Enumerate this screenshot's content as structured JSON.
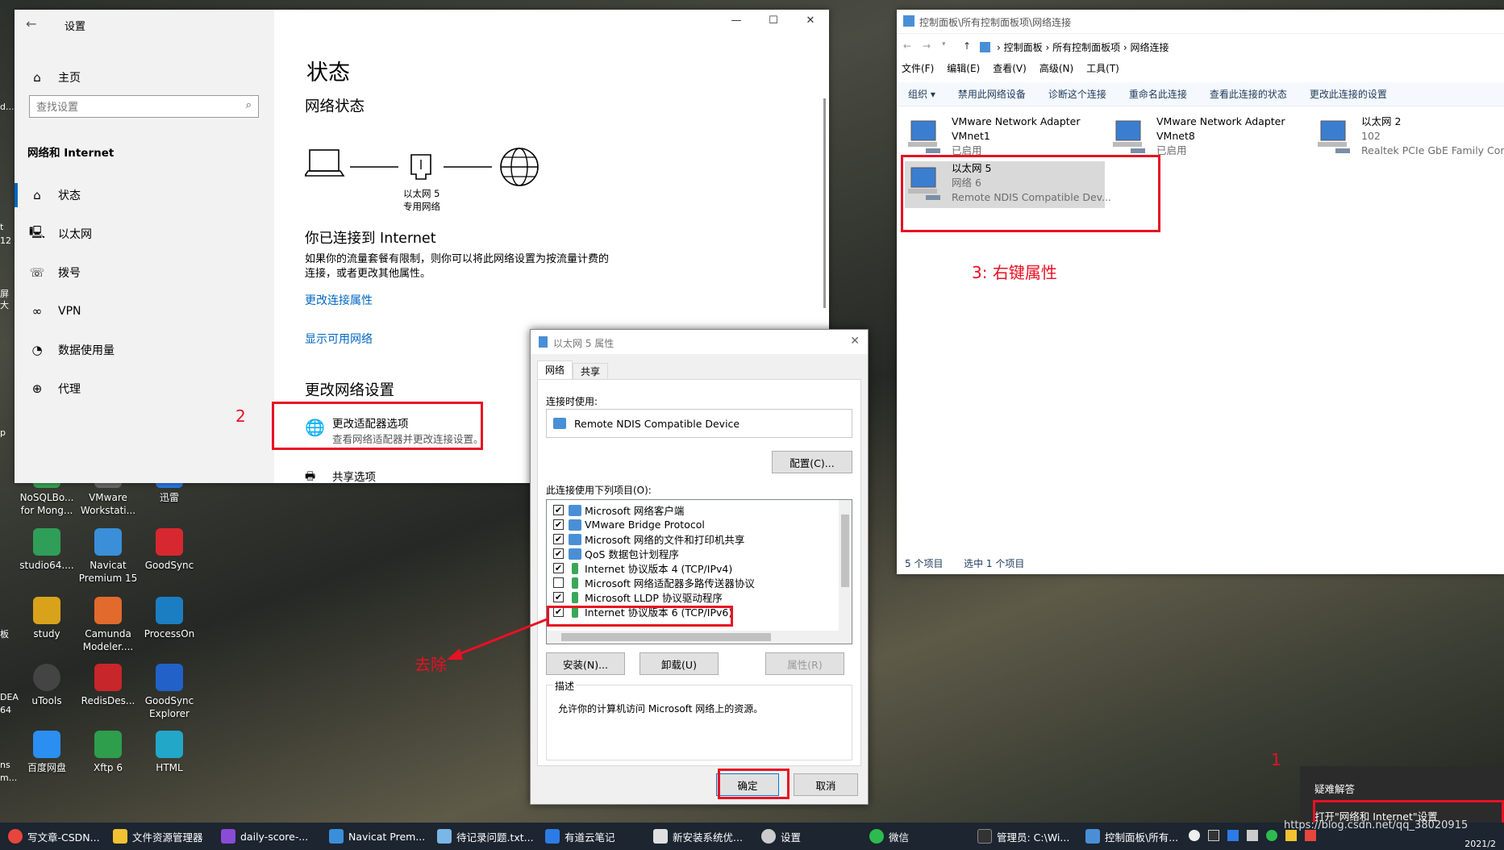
{
  "desktop": {
    "icons": [
      {
        "label": "NoSQLBo... for Mong...",
        "color": "#3aa757"
      },
      {
        "label": "VMware Workstati...",
        "color": "#6b6b6b"
      },
      {
        "label": "迅雷",
        "color": "#2d7be5"
      },
      {
        "label": "studio64....",
        "color": "#2f9e58"
      },
      {
        "label": "Navicat Premium 15",
        "color": "#3a8fd8"
      },
      {
        "label": "GoodSync",
        "color": "#d8282f"
      },
      {
        "label": "study",
        "color": "#d9a21b"
      },
      {
        "label": "Camunda Modeler....",
        "color": "#e26a2c"
      },
      {
        "label": "ProcessOn",
        "color": "#1b7ec2"
      },
      {
        "label": "uTools",
        "color": "#444444"
      },
      {
        "label": "RedisDes...",
        "color": "#c7262b"
      },
      {
        "label": "GoodSync Explorer",
        "color": "#2161c8"
      },
      {
        "label": "百度网盘",
        "color": "#2a8ff0"
      },
      {
        "label": "Xftp 6",
        "color": "#2e9e4d"
      },
      {
        "label": "HTML",
        "color": "#23a7c9"
      }
    ],
    "left_edge": [
      "d...",
      "12",
      "屏大",
      "t",
      "p",
      "板",
      "DEA",
      "64",
      "ns",
      "m..."
    ]
  },
  "settings": {
    "title": "设置",
    "controls": {
      "minimize": "—",
      "maximize": "☐",
      "close": "✕"
    },
    "home": "主页",
    "search_placeholder": "查找设置",
    "section": "网络和 Internet",
    "nav": [
      {
        "label": "状态",
        "icon": "⌂"
      },
      {
        "label": "以太网",
        "icon": "🖳"
      },
      {
        "label": "拨号",
        "icon": "☏"
      },
      {
        "label": "VPN",
        "icon": "∞"
      },
      {
        "label": "数据使用量",
        "icon": "◔"
      },
      {
        "label": "代理",
        "icon": "⊕"
      }
    ],
    "page_title": "状态",
    "network_status": "网络状态",
    "adapter_name": "以太网 5",
    "adapter_type": "专用网络",
    "connected_title": "你已连接到 Internet",
    "connected_desc_1": "如果你的流量套餐有限制，则你可以将此网络设置为按流量计费的",
    "connected_desc_2": "连接，或者更改其他属性。",
    "link_change_props": "更改连接属性",
    "link_show_networks": "显示可用网络",
    "change_settings": "更改网络设置",
    "adapter_options_title": "更改适配器选项",
    "adapter_options_desc": "查看网络适配器并更改连接设置。",
    "sharing_options": "共享选项",
    "annotation": "2"
  },
  "control_panel": {
    "title": "控制面板\\所有控制面板项\\网络连接",
    "breadcrumb": [
      "控制面板",
      "所有控制面板项",
      "网络连接"
    ],
    "menu": [
      "文件(F)",
      "编辑(E)",
      "查看(V)",
      "高级(N)",
      "工具(T)"
    ],
    "toolbar": [
      "组织 ▾",
      "禁用此网络设备",
      "诊断这个连接",
      "重命名此连接",
      "查看此连接的状态",
      "更改此连接的设置"
    ],
    "adapters": [
      {
        "name": "VMware Network Adapter",
        "line2": "VMnet1",
        "line3": "已启用"
      },
      {
        "name": "VMware Network Adapter",
        "line2": "VMnet8",
        "line3": "已启用"
      },
      {
        "name": "以太网 2",
        "line2": "102",
        "line3": "Realtek PCIe GbE Family Contr..."
      },
      {
        "name": "以太网 5",
        "line2": "网络 6",
        "line3": "Remote NDIS Compatible Dev..."
      }
    ],
    "status_count": "5 个项目",
    "status_selected": "选中 1 个项目",
    "annotation": "3: 右键属性"
  },
  "props_dialog": {
    "title": "以太网 5 属性",
    "tabs": [
      "网络",
      "共享"
    ],
    "connect_using_label": "连接时使用:",
    "device": "Remote NDIS Compatible Device",
    "configure_button": "配置(C)...",
    "items_label": "此连接使用下列项目(O):",
    "items": [
      {
        "label": "Microsoft 网络客户端",
        "checked": "✔"
      },
      {
        "label": "VMware Bridge Protocol",
        "checked": "✔"
      },
      {
        "label": "Microsoft 网络的文件和打印机共享",
        "checked": "✔"
      },
      {
        "label": "QoS 数据包计划程序",
        "checked": "✔"
      },
      {
        "label": "Internet 协议版本 4 (TCP/IPv4)",
        "checked": "✔"
      },
      {
        "label": "Microsoft 网络适配器多路传送器协议",
        "checked": ""
      },
      {
        "label": "Microsoft LLDP 协议驱动程序",
        "checked": "✔"
      },
      {
        "label": "Internet 协议版本 6 (TCP/IPv6)",
        "checked": "✔"
      }
    ],
    "install_button": "安装(N)...",
    "uninstall_button": "卸载(U)",
    "properties_button": "属性(R)",
    "description_label": "描述",
    "description_text": "允许你的计算机访问 Microsoft 网络上的资源。",
    "ok_button": "确定",
    "cancel_button": "取消",
    "annotation": "去除"
  },
  "context_menu": {
    "items": [
      "疑难解答",
      "打开\"网络和 Internet\"设置"
    ],
    "annotation": "1"
  },
  "taskbar": {
    "items": [
      {
        "label": "写文章-CSDN...",
        "color": "#e8453c"
      },
      {
        "label": "文件资源管理器",
        "color": "#f2c231"
      },
      {
        "label": "daily-score-...",
        "color": "#8a4bd6"
      },
      {
        "label": "Navicat Prem...",
        "color": "#3a8fd8"
      },
      {
        "label": "待记录问题.txt...",
        "color": "#7ab6e6"
      },
      {
        "label": "有道云笔记",
        "color": "#2d7be5"
      },
      {
        "label": "新安装系统优...",
        "color": "#e0e0e0"
      },
      {
        "label": "设置",
        "color": "#cccccc"
      },
      {
        "label": "微信",
        "color": "#2dbb4f"
      },
      {
        "label": "管理员: C:\\Wi...",
        "color": "#333333"
      },
      {
        "label": "控制面板\\所有...",
        "color": "#4a8fd6"
      }
    ],
    "watermark": "https://blog.csdn.net/qq_38020915",
    "clock": "2021/2"
  }
}
